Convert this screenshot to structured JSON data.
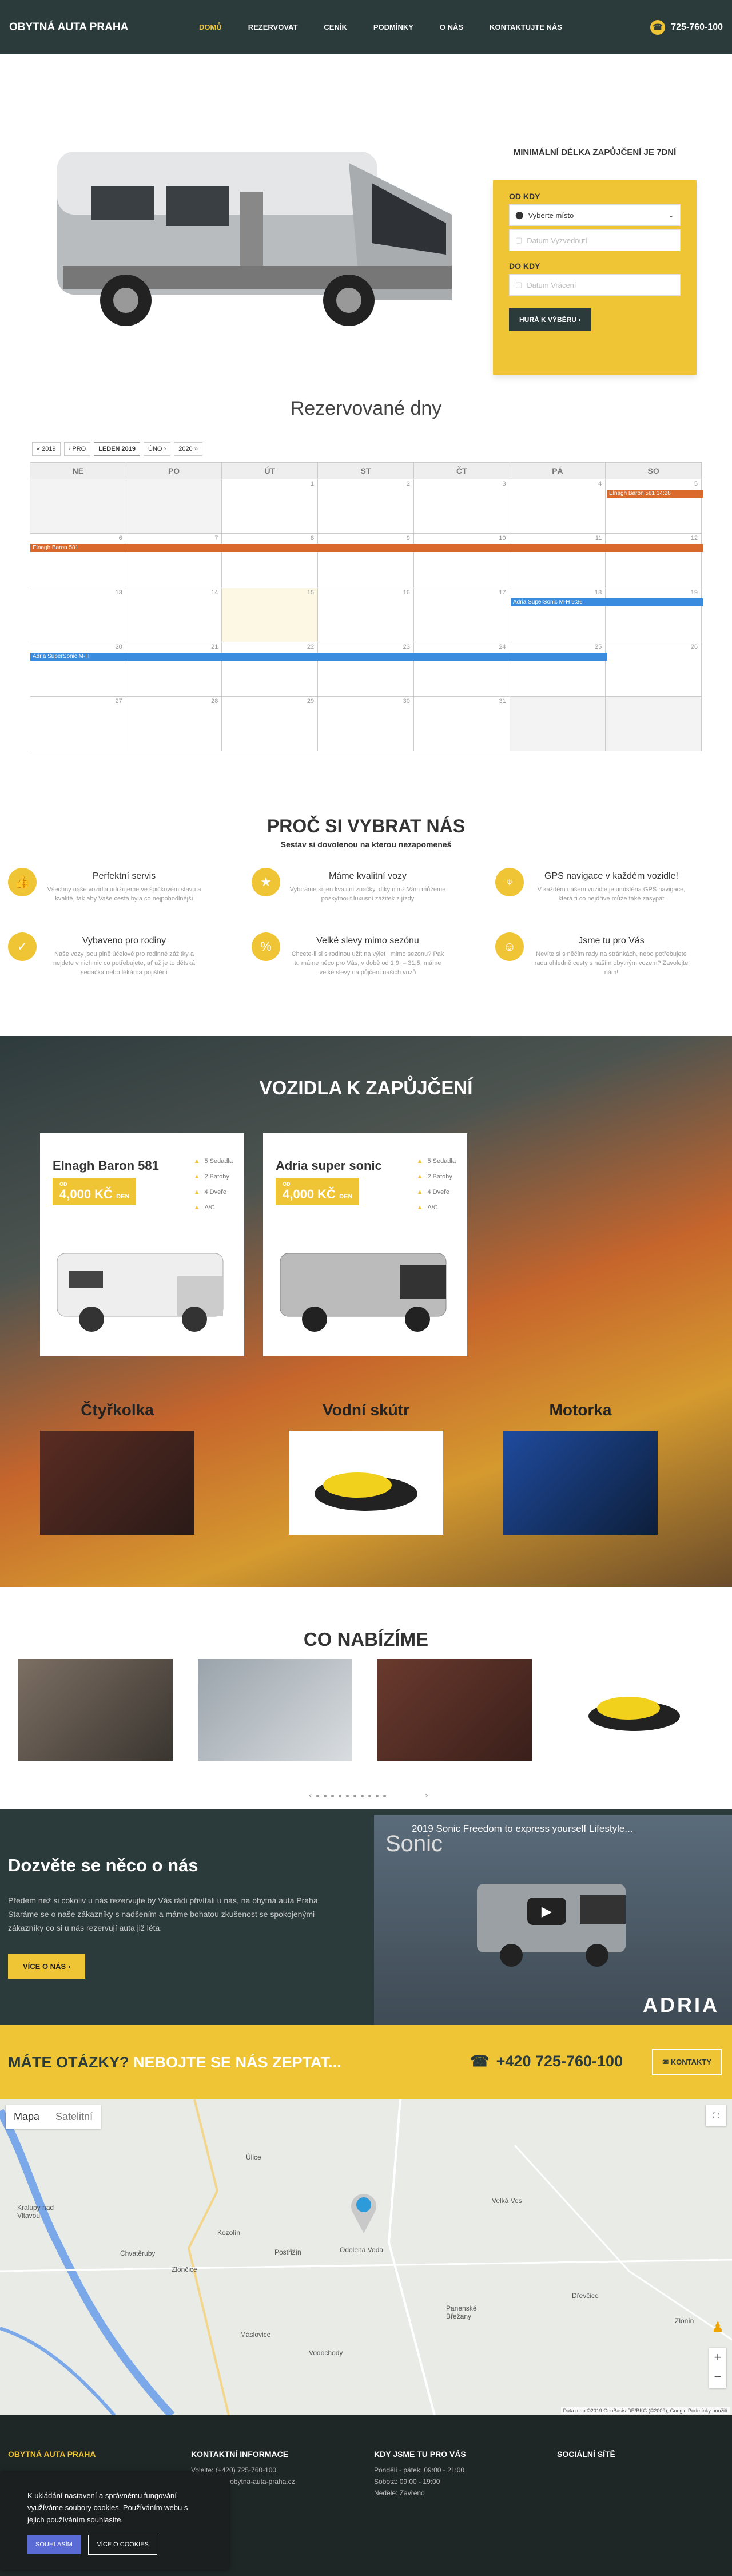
{
  "header": {
    "logo": "OBYTNÁ AUTA PRAHA",
    "nav": [
      "DOMŮ",
      "REZERVOVAT",
      "CENÍK",
      "PODMÍNKY",
      "O NÁS",
      "KONTAKTUJTE NÁS"
    ],
    "phone": "725-760-100"
  },
  "booking": {
    "title": "MINIMÁLNÍ DÉLKA ZAPŮJČENÍ JE 7DNÍ",
    "from_label": "OD KDY",
    "place_value": "Vyberte místo",
    "pickup_placeholder": "Datum Vyzvednutí",
    "to_label": "DO KDY",
    "return_placeholder": "Datum Vrácení",
    "submit": "HURÁ K VÝBĚRU ›"
  },
  "calendar": {
    "title": "Rezervované dny",
    "controls": [
      "« 2019",
      "‹ PRO",
      "LEDEN 2019",
      "ÚNO ›",
      "2020 »"
    ],
    "weekdays": [
      "NE",
      "PO",
      "ÚT",
      "ST",
      "ČT",
      "PÁ",
      "SO"
    ],
    "weeks": [
      [
        "",
        "",
        "1",
        "2",
        "3",
        "4",
        "5"
      ],
      [
        "6",
        "7",
        "8",
        "9",
        "10",
        "11",
        "12"
      ],
      [
        "13",
        "14",
        "15",
        "16",
        "17",
        "18",
        "19"
      ],
      [
        "20",
        "21",
        "22",
        "23",
        "24",
        "25",
        "26"
      ],
      [
        "27",
        "28",
        "29",
        "30",
        "31",
        "",
        ""
      ]
    ],
    "events": {
      "w1": "Elnagh Baron 581 14:28",
      "w2": "Elnagh Baron 581",
      "w3": "Adria SuperSonic M-H 9:36",
      "w4": "Adria SuperSonic M-H"
    }
  },
  "why": {
    "title": "PROČ SI VYBRAT NÁS",
    "subtitle": "Sestav si dovolenou na kterou nezapomeneš",
    "features": [
      {
        "title": "Perfektní servis",
        "text": "Všechny naše vozidla udržujeme ve špičkovém stavu a kvalitě, tak aby Vaše cesta byla co nejpohodlnější"
      },
      {
        "title": "Máme kvalitní vozy",
        "text": "Vybíráme si jen kvalitní značky, díky nimž Vám můžeme poskytnout luxusní zážitek z jízdy"
      },
      {
        "title": "GPS navigace v každém vozidle!",
        "text": "V každém našem vozidle je umístěna GPS navigace, která ti co nejdříve může také zasypat"
      },
      {
        "title": "Vybaveno pro rodiny",
        "text": "Naše vozy jsou plně účelové pro rodinné zážitky a nejdete v nich nic co potřebujete, ať už je to dětská sedačka nebo lékárna pojištění"
      },
      {
        "title": "Velké slevy mimo sezónu",
        "text": "Chcete-li si s rodinou užít na výlet i mimo sezonu? Pak tu máme něco pro Vás, v době od 1.9. – 31.5. máme velké slevy na půjčení našich vozů"
      },
      {
        "title": "Jsme tu pro Vás",
        "text": "Nevíte si s něčím rady na stránkách, nebo potřebujete radu ohledně cesty s naším obytným vozem? Zavolejte nám!"
      }
    ]
  },
  "vehicles": {
    "title": "VOZIDLA K ZAPŮJČENÍ",
    "cards": [
      {
        "name": "Elnagh Baron 581",
        "price_from": "OD",
        "price": "4,000 KČ",
        "unit": "DEN",
        "specs": [
          "5 Sedadla",
          "2 Batohy",
          "4 Dveře",
          "A/C"
        ]
      },
      {
        "name": "Adria super sonic",
        "price_from": "OD",
        "price": "4,000 KČ",
        "unit": "DEN",
        "specs": [
          "5 Sedadla",
          "2 Batohy",
          "4 Dveře",
          "A/C"
        ]
      }
    ],
    "categories": [
      "Čtyřkolka",
      "Vodní skútr",
      "Motorka"
    ]
  },
  "offer": {
    "title": "CO NABÍZÍME"
  },
  "about": {
    "title": "Dozvěte se něco o nás",
    "text": "Předem než si cokoliv u nás rezervujte by Vás rádi přivítali u nás, na obytná auta Praha. Staráme se o naše zákazníky s nadšením a máme bohatou zkušenost se spokojenými zákazníky co si u nás rezervují auta již léta.",
    "button": "VÍCE O NÁS ›",
    "video_title": "2019 Sonic Freedom to express yourself Lifestyle...",
    "video_brand": "ADRIA",
    "video_caption": "Sonic"
  },
  "cta": {
    "question": "MÁTE OTÁZKY?",
    "highlight": "NEBOJTE SE NÁS ZEPTAT...",
    "phone": "+420 725-760-100",
    "button": "KONTAKTY"
  },
  "map": {
    "tabs": [
      "Mapa",
      "Satelitní"
    ],
    "towns": [
      "Úlice",
      "Velká Ves",
      "Kozolín",
      "Chvatěruby",
      "Zlončice",
      "Odolena Voda",
      "Kralupy nad Vltavou",
      "Postřižín",
      "Dřevčice",
      "Panenské Břežany",
      "Máslovice",
      "Vodochody",
      "Zlonín"
    ],
    "attribution": "Data map ©2019 GeoBasis-DE/BKG (©2009), Google   Podmínky použití"
  },
  "footer": {
    "col1": "OBYTNÁ AUTA PRAHA",
    "col2": "KONTAKTNÍ INFORMACE",
    "col2_lines": [
      "Volejte: (+420) 725-760-100",
      "Email: info@obytna-auta-praha.cz"
    ],
    "col3": "KDY JSME TU PRO VÁS",
    "col3_lines": [
      "Pondělí - pátek: 09:00 - 21:00",
      "Sobota: 09:00 - 19:00",
      "Neděle: Zavřeno"
    ],
    "col4": "SOCIÁLNÍ SÍTĚ"
  },
  "cookie": {
    "text": "K ukládání nastavení a správnému fungování využíváme soubory cookies. Používáním webu s jejich používáním souhlasíte.",
    "agree": "SOUHLASÍM",
    "more": "VÍCE O COOKIES"
  },
  "colors": {
    "accent": "#f0c535",
    "dark": "#2b3a3a",
    "event_orange": "#d96a2b",
    "event_blue": "#3a8dde"
  }
}
